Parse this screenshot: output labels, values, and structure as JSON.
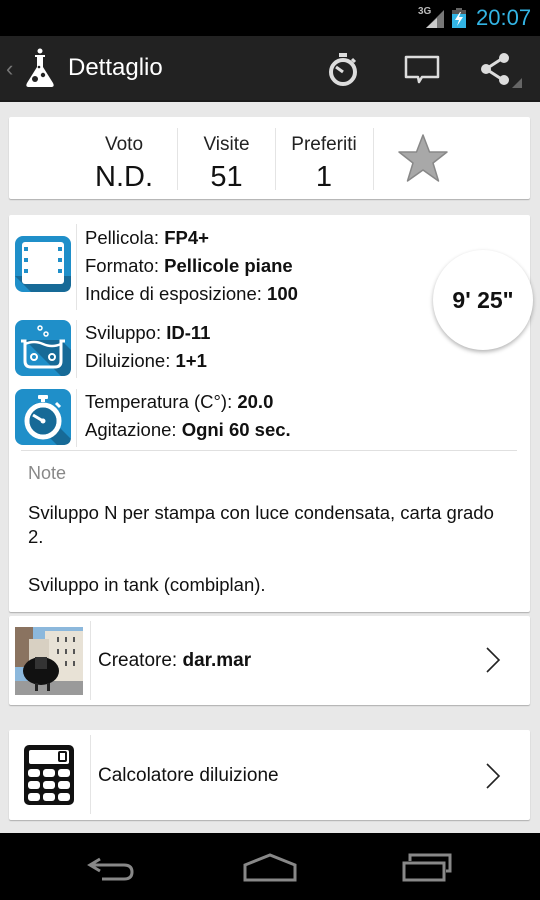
{
  "status_bar": {
    "network": "3G",
    "time": "20:07",
    "accent_color": "#33b5e5"
  },
  "action_bar": {
    "title": "Dettaglio",
    "actions": [
      {
        "icon": "stopwatch-icon",
        "label": "Timer"
      },
      {
        "icon": "comment-icon",
        "label": "Commenti"
      },
      {
        "icon": "share-icon",
        "label": "Condividi"
      }
    ]
  },
  "stats": {
    "vote": {
      "label": "Voto",
      "value": "N.D."
    },
    "visits": {
      "label": "Visite",
      "value": "51"
    },
    "favorites": {
      "label": "Preferiti",
      "value": "1"
    },
    "favorite_icon": "star-icon"
  },
  "details": {
    "film": {
      "icon": "film-icon",
      "lines": [
        {
          "label": "Pellicola: ",
          "value": "FP4+"
        },
        {
          "label": "Formato: ",
          "value": "Pellicole piane"
        },
        {
          "label": "Indice di esposizione: ",
          "value": "100"
        }
      ]
    },
    "developer": {
      "icon": "developer-bath-icon",
      "lines": [
        {
          "label": "Sviluppo: ",
          "value": "ID-11"
        },
        {
          "label": "Diluizione: ",
          "value": "1+1"
        }
      ]
    },
    "process": {
      "icon": "stopwatch-icon",
      "lines": [
        {
          "label": "Temperatura (C°): ",
          "value": "20.0"
        },
        {
          "label": "Agitazione: ",
          "value": "Ogni 60 sec."
        }
      ]
    },
    "timer": "9' 25\"",
    "notes_label": "Note",
    "notes": "Sviluppo N per stampa con luce condensata, carta grado 2.\n\nSviluppo in tank (combiplan).",
    "icon_color": "#1f8fc9"
  },
  "creator": {
    "label": "Creatore: ",
    "value": "dar.mar"
  },
  "calculator": {
    "label": "Calcolatore diluizione"
  },
  "nav_bar": {
    "back": "back-icon",
    "home": "home-icon",
    "recents": "recents-icon"
  }
}
